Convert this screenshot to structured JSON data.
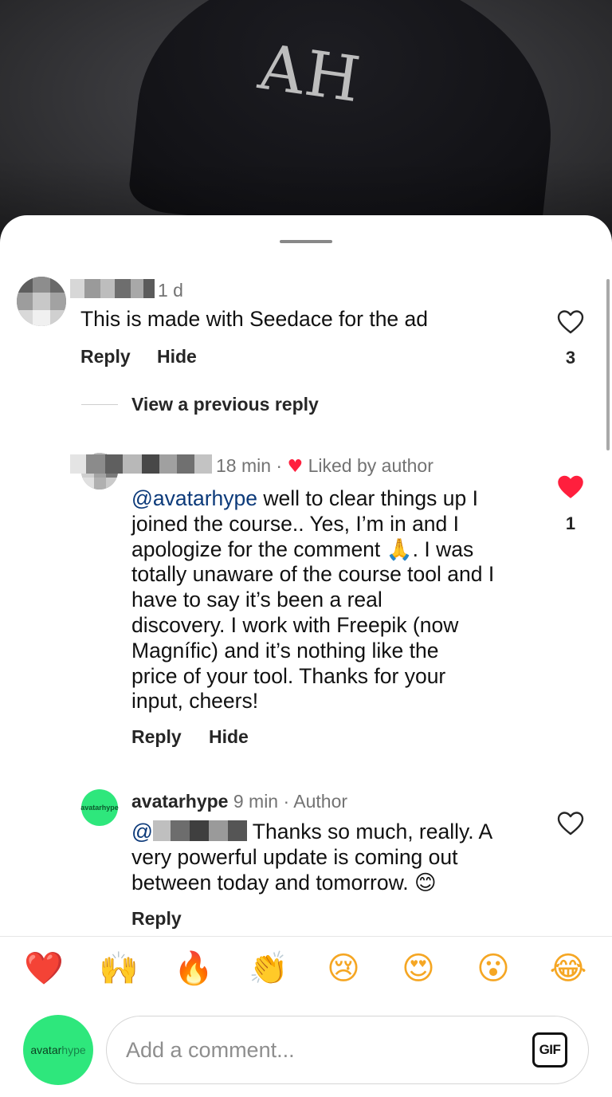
{
  "background": {
    "cap_text": "AH"
  },
  "comments": [
    {
      "time": "1 d",
      "text": "This is made with Seedace for the ad",
      "reply_label": "Reply",
      "hide_label": "Hide",
      "like_count": "3",
      "liked": false
    }
  ],
  "view_previous": "View a previous reply",
  "replies": [
    {
      "time": "18 min · ",
      "liked_by_author": "Liked by author",
      "mention": "@avatarhype",
      "text_lines": [
        " well to clear things up I",
        "joined the course.. Yes, I’m in and I",
        "apologize for the comment 🙏. I was",
        "totally unaware of the course tool and I",
        "have to say it’s been a real",
        "discovery. I work with Freepik (now",
        "Magnífic) and it’s nothing like the",
        "price of your tool. Thanks for your",
        "input, cheers!"
      ],
      "reply_label": "Reply",
      "hide_label": "Hide",
      "like_count": "1",
      "liked": true
    },
    {
      "username": "avatarhype",
      "time": "9 min · Author",
      "mention_prefix": "@",
      "text_lines": [
        "Thanks so much, really. A",
        "very powerful update is coming out",
        "between today and tomorrow. 😊"
      ],
      "reply_label": "Reply",
      "liked": false,
      "avatar_logo": "avatarhype"
    }
  ],
  "reactions": [
    {
      "emoji": "❤️",
      "icon": "red-heart-emoji"
    },
    {
      "emoji": "🙌",
      "icon": "raising-hands-emoji"
    },
    {
      "emoji": "🔥",
      "icon": "fire-emoji"
    },
    {
      "emoji": "👏",
      "icon": "clapping-hands-emoji"
    },
    {
      "emoji": "😢",
      "icon": "crying-face-emoji"
    },
    {
      "emoji": "😍",
      "icon": "heart-eyes-emoji"
    },
    {
      "emoji": "😮",
      "icon": "surprised-face-emoji"
    },
    {
      "emoji": "😂",
      "icon": "tears-of-joy-emoji"
    }
  ],
  "composer": {
    "placeholder": "Add a comment...",
    "gif_label": "GIF",
    "avatar_logo_a": "avatar",
    "avatar_logo_b": "hype"
  },
  "colors": {
    "heart_liked": "#ff1f3d",
    "mention": "#0c3a7a",
    "avatar_green": "#2ee77c"
  }
}
